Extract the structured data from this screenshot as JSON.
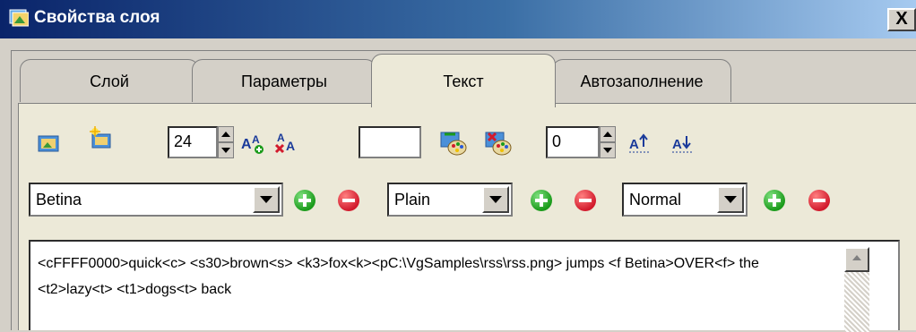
{
  "window": {
    "title": "Свойства слоя",
    "close_label": "X"
  },
  "tabs": [
    {
      "label": "Слой"
    },
    {
      "label": "Параметры"
    },
    {
      "label": "Текст",
      "active": true
    },
    {
      "label": "Автозаполнение"
    }
  ],
  "toolbar": {
    "font_size_value": "24",
    "color_value": "",
    "spacing_value": "0"
  },
  "font_selectors": {
    "font_family": "Betina",
    "font_style": "Plain",
    "font_weight": "Normal"
  },
  "text_content": "<cFFFF0000>quick<c> <s30>brown<s> <k3>fox<k><pC:\\VgSamples\\rss\\rss.png> jumps <f Betina>OVER<f> the <t2>lazy<t> <t1>dogs<t> back",
  "colors": {
    "title_start": "#0a246a",
    "title_end": "#a6caf0",
    "face": "#d4d0c8",
    "panel": "#ece9d8",
    "add": "#1b9b1b",
    "remove": "#d21b2d"
  },
  "icons": [
    "layer-app-icon",
    "image-icon",
    "new-image-icon",
    "font-grow-icon",
    "font-remove-icon",
    "color-palette-add-icon",
    "color-palette-remove-icon",
    "spacing-up-icon",
    "spacing-down-icon"
  ]
}
